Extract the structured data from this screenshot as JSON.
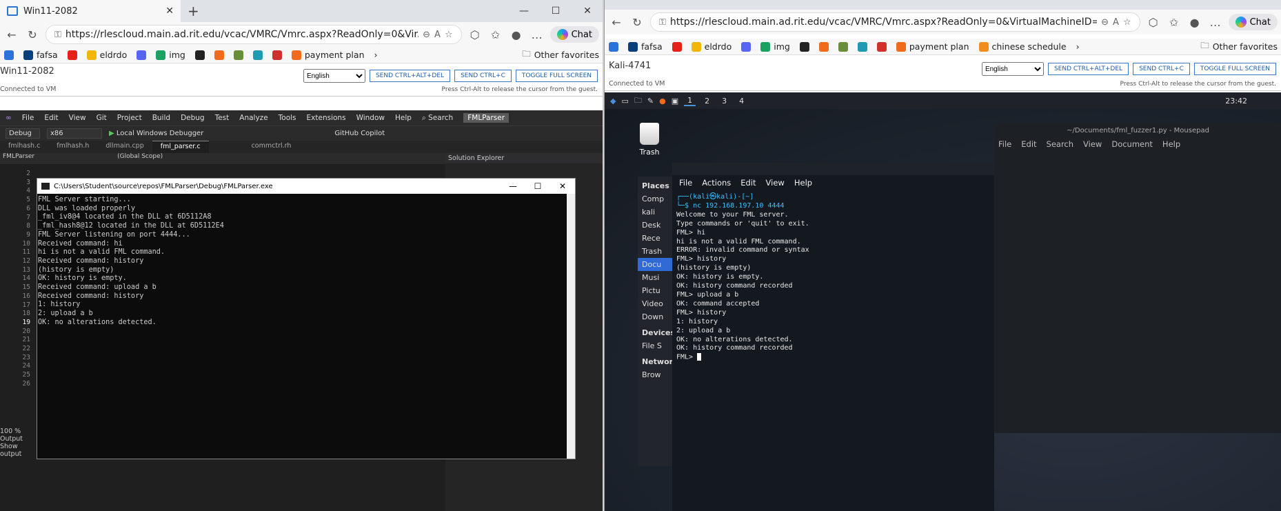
{
  "left": {
    "tab_title": "Win11-2082",
    "url": "https://rlescloud.main.ad.rit.edu/vcac/VMRC/Vmrc.aspx?ReadOnly=0&Vir...",
    "chat": "Chat",
    "favorites": [
      "fafsa",
      "eldrdo",
      "img",
      "payment plan"
    ],
    "other_favorites": "Other favorites",
    "vm_name": "Win11-2082",
    "connected": "Connected to VM",
    "language": "English",
    "btn_cad": "SEND CTRL+ALT+DEL",
    "btn_cc": "SEND CTRL+C",
    "btn_fs": "TOGGLE FULL SCREEN",
    "hint": "Press Ctrl-Alt to release the cursor from the guest.",
    "vs": {
      "menu": [
        "File",
        "Edit",
        "View",
        "Git",
        "Project",
        "Build",
        "Debug",
        "Test",
        "Analyze",
        "Tools",
        "Extensions",
        "Window",
        "Help"
      ],
      "search": "Search",
      "project_badge": "FMLParser",
      "config": "Debug",
      "platform": "x86",
      "debugger": "Local Windows Debugger",
      "copilot": "GitHub Copilot",
      "tabs": [
        "fmlhash.c",
        "fmlhash.h",
        "dllmain.cpp",
        "fml_parser.c"
      ],
      "extra_tab": "commctrl.rh",
      "scope_left": "FMLParser",
      "scope_right": "(Global Scope)",
      "solution_explorer": "Solution Explorer",
      "zoom": "100 %",
      "output": "Output",
      "show_output": "Show output"
    },
    "console": {
      "title": "C:\\Users\\Student\\source\\repos\\FMLParser\\Debug\\FMLParser.exe",
      "lines": "FML Server starting...\nDLL was loaded properly\n_fml_iv8@4 located in the DLL at 6D5112A8\n_fml_hash8@12 located in the DLL at 6D5112E4\nFML Server listening on port 4444...\nReceived command: hi\nhi is not a valid FML command.\nReceived command: history\n(history is empty)\nOK: history is empty.\nReceived command: upload a b\nReceived command: history\n1: history\n2: upload a b\nOK: no alterations detected."
    }
  },
  "right": {
    "url": "https://rlescloud.main.ad.rit.edu/vcac/VMRC/Vmrc.aspx?ReadOnly=0&VirtualMachineID=...",
    "chat": "Chat",
    "favorites": [
      "fafsa",
      "eldrdo",
      "img",
      "payment plan",
      "chinese schedule"
    ],
    "other_favorites": "Other favorites",
    "vm_name": "Kali-4741",
    "connected": "Connected to VM",
    "language": "English",
    "btn_cad": "SEND CTRL+ALT+DEL",
    "btn_cc": "SEND CTRL+C",
    "btn_fs": "TOGGLE FULL SCREEN",
    "hint": "Press Ctrl-Alt to release the cursor from the guest.",
    "kali": {
      "workspaces": [
        "1",
        "2",
        "3",
        "4"
      ],
      "time": "23:42",
      "trash": "Trash",
      "mousepad_title": "~/Documents/fml_fuzzer1.py - Mousepad",
      "mousepad_menu": [
        "File",
        "Edit",
        "Search",
        "View",
        "Document",
        "Help"
      ],
      "fm_places": "Places",
      "fm_items": [
        "Comp",
        "kali",
        "Desk",
        "Rece",
        "Trash",
        "Docu",
        "Musi",
        "Pictu",
        "Video",
        "Down"
      ],
      "fm_devices": "Devices",
      "fm_filesystem": "File S",
      "fm_network": "Network",
      "fm_browse": "Brow",
      "term_menu": [
        "File",
        "Actions",
        "Edit",
        "View",
        "Help"
      ],
      "term_prompt": "┌──(kali㉿kali)-[~]",
      "term_cmd": "└─$ nc 192.168.197.10 4444",
      "term_lines": "Welcome to your FML server.\nType commands or 'quit' to exit.\nFML> hi\nhi is not a valid FML command.\nERROR: invalid command or syntax\nFML> history\n(history is empty)\nOK: history is empty.\nOK: history command recorded\nFML> upload a b\nOK: command accepted\nFML> history\n1: history\n2: upload a b\nOK: no alterations detected.\nOK: history command recorded",
      "term_last": "FML> "
    }
  }
}
